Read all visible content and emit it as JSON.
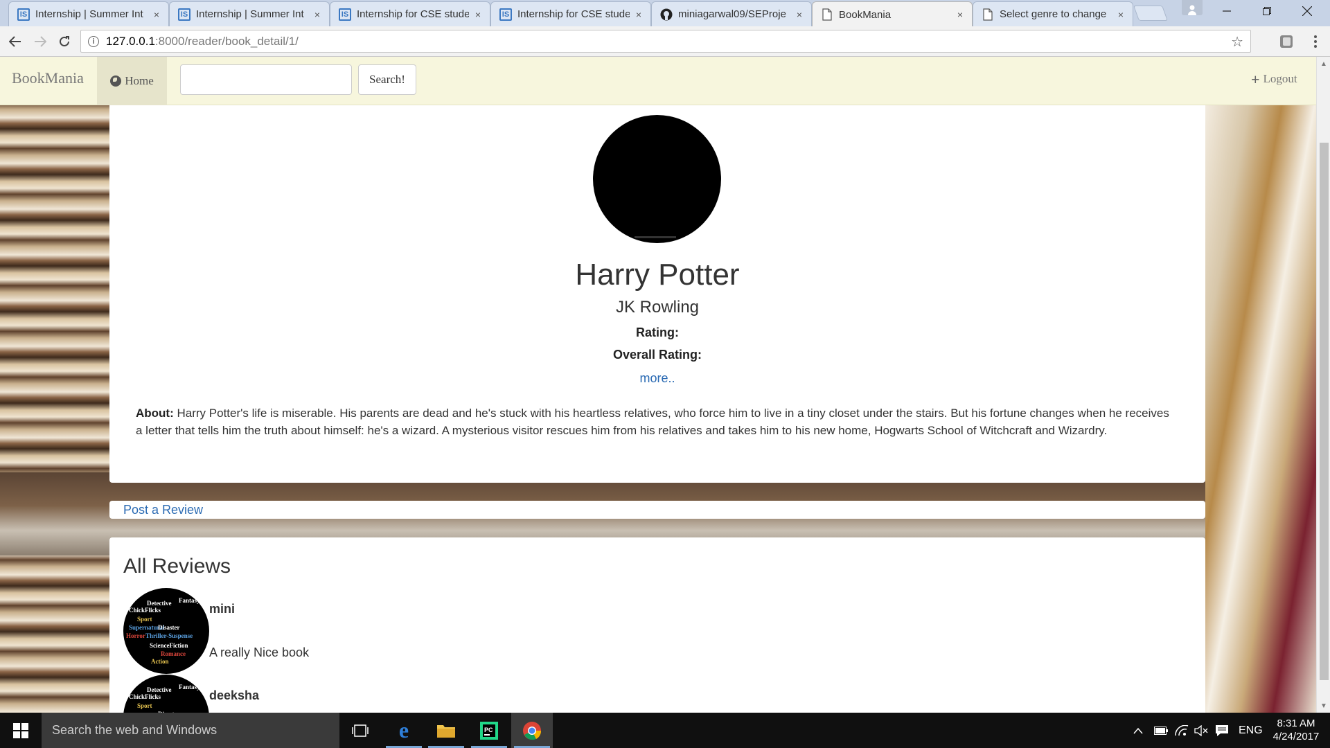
{
  "browser": {
    "tabs": [
      {
        "title": "Internship | Summer Int",
        "icon": "internshala-icon",
        "active": false
      },
      {
        "title": "Internship | Summer Int",
        "icon": "internshala-icon",
        "active": false
      },
      {
        "title": "Internship for CSE stude",
        "icon": "internshala-icon",
        "active": false
      },
      {
        "title": "Internship for CSE stude",
        "icon": "internshala-icon",
        "active": false
      },
      {
        "title": "miniagarwal09/SEProje",
        "icon": "github-icon",
        "active": false
      },
      {
        "title": "BookMania",
        "icon": "page-icon",
        "active": true
      },
      {
        "title": "Select genre to change",
        "icon": "page-icon",
        "active": false
      }
    ],
    "tab_close_glyph": "×",
    "url_host": "127.0.0.1",
    "url_path": ":8000/reader/book_detail/1/"
  },
  "site": {
    "brand": "BookMania",
    "home_label": "Home",
    "search_value": "",
    "search_button": "Search!",
    "logout_label": "Logout"
  },
  "book": {
    "title": "Harry Potter",
    "author": "JK Rowling",
    "rating_label": "Rating:",
    "overall_rating_label": "Overall Rating:",
    "more_link": "more..",
    "about_label": "About:",
    "about_text": "Harry Potter's life is miserable. His parents are dead and he's stuck with his heartless relatives, who force him to live in a tiny closet under the stairs. But his fortune changes when he receives a letter that tells him the truth about himself: he's a wizard. A mysterious visitor rescues him from his relatives and takes him to his new home, Hogwarts School of Witchcraft and Wizardry."
  },
  "post_review_link": "Post a Review",
  "reviews": {
    "heading": "All Reviews",
    "items": [
      {
        "username": "mini",
        "text": "A really Nice book"
      },
      {
        "username": "deeksha",
        "text": ""
      }
    ],
    "avatar_words": [
      "Detective",
      "Fantasy",
      "ChickFlicks",
      "Sport",
      "Supernatural",
      "Disaster",
      "Horror",
      "Thriller-Suspense",
      "ScienceFiction",
      "Romance",
      "Action"
    ]
  },
  "taskbar": {
    "search_placeholder": "Search the web and Windows",
    "language": "ENG",
    "time": "8:31 AM",
    "date": "4/24/2017"
  },
  "colors": {
    "navbar_bg": "#f7f6dd",
    "link": "#2a6ab3",
    "taskbar_bg": "#101010"
  }
}
